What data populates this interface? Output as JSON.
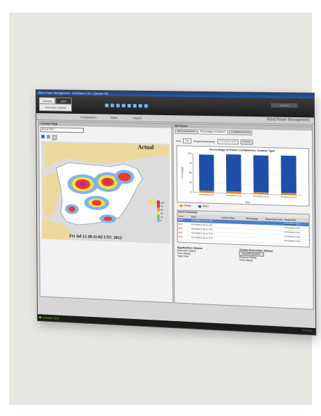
{
  "window": {
    "title": "Wind Power Management - EnaPlace V 3.0 - Ejemplo NC"
  },
  "tabs": [
    {
      "label": "Central"
    },
    {
      "label": "MAP"
    }
  ],
  "menubar": {
    "items": [
      {
        "label": "Overview Central"
      },
      {
        "label": "Configuration"
      },
      {
        "label": "Maps"
      },
      {
        "label": "Report"
      }
    ],
    "app_title": "Wind Power Management"
  },
  "toolbar": {
    "brand": "Iberdrola"
  },
  "left_panel": {
    "title": "Contour Map",
    "select_value": "Actual PRC",
    "map": {
      "title": "Actual",
      "timestamp": "Fri Jul 13 20:11:02 UTC 2012"
    },
    "scale": [
      "100",
      "75",
      "50",
      "25",
      "10",
      "5"
    ]
  },
  "right_panel": {
    "title": "Wf Power",
    "subtabs": [
      "Wind production",
      "Percentage production",
      "Curtailment trend"
    ],
    "controls": {
      "range_label": "Area",
      "range_value": "Day",
      "period_label": "Request timestamp",
      "date_value": "07/13/2012 19:41",
      "button": "Refresh"
    },
    "chart_data": {
      "type": "bar",
      "title": "Percentage of Power Curtailment, Control Type",
      "categories": [
        "07/13/2012 20:11",
        "07/13/2012 20:11",
        "07/13/2012 20:11",
        "07/13/2012 20:11"
      ],
      "series": [
        {
          "name": "Check",
          "color": "#e88a1a",
          "values": [
            5,
            5,
            5,
            5
          ]
        },
        {
          "name": "Wind",
          "color": "#1f4fa8",
          "values": [
            93,
            95,
            94,
            95
          ]
        }
      ],
      "ylim": [
        0,
        100
      ],
      "yticks": [
        "100",
        "75",
        "50",
        "25",
        "0"
      ],
      "xlabel": "Time",
      "ylabel": "Percentage"
    },
    "grid": {
      "title": "Event Summary",
      "headers": [
        "Area",
        "Date",
        "Control Type",
        "Percentage",
        "Requested Limit",
        "Requested Timestamp"
      ],
      "rows": [
        [
          "BPS",
          "07/13/2012 20:11 UTC",
          "",
          "",
          "",
          "07/13/2012 20:1"
        ],
        [
          "BPS",
          "07/13/2012 20:11 UTC",
          "",
          "",
          "",
          "07/13/2012 20:1"
        ],
        [
          "BPS",
          "07/13/2012 20:11 UTC",
          "",
          "",
          "",
          "07/13/2012 20:1"
        ],
        [
          "BPS",
          "07/13/2012 20:11 UTC",
          "",
          "",
          "",
          "07/13/2012 20:1"
        ],
        [
          "BPS",
          "07/13/2012 20:11 UTC",
          "",
          "",
          "",
          "07/13/2012 20:1"
        ]
      ]
    }
  },
  "app_status": {
    "title": "Application Status",
    "lines": [
      "Execution Status",
      "Time Stamp",
      "Total Time"
    ]
  },
  "global_status": {
    "title": "Global Execution Status",
    "button": "Reset/Execution",
    "lines": [
      "Request Status",
      "Time Stamp"
    ]
  },
  "status": {
    "connected": "CONNECTED",
    "right": "Iberdrola"
  }
}
